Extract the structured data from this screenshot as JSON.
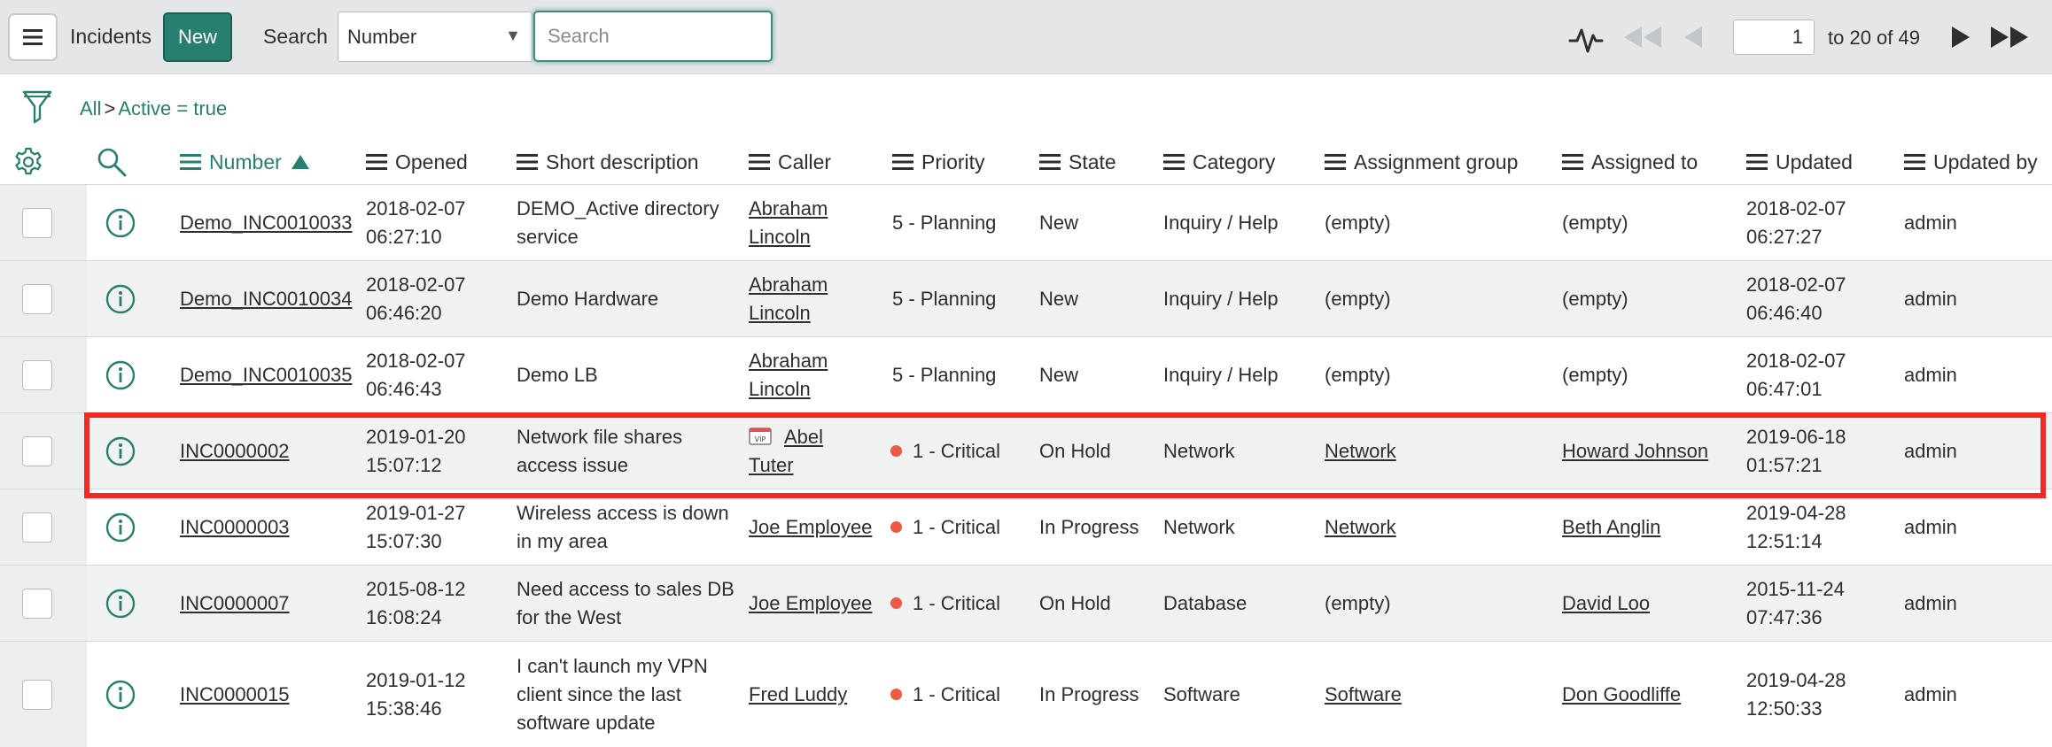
{
  "header": {
    "module_title": "Incidents",
    "new_label": "New",
    "search_label": "Search",
    "field_select_value": "Number",
    "search_placeholder": "Search",
    "page_number": "1",
    "page_range": "to 20 of 49"
  },
  "breadcrumb": {
    "all": "All",
    "separator": ">",
    "filter": "Active = true"
  },
  "columns": [
    {
      "label": "Number",
      "sorted": "ascending"
    },
    {
      "label": "Opened"
    },
    {
      "label": "Short description"
    },
    {
      "label": "Caller"
    },
    {
      "label": "Priority"
    },
    {
      "label": "State"
    },
    {
      "label": "Category"
    },
    {
      "label": "Assignment group"
    },
    {
      "label": "Assigned to"
    },
    {
      "label": "Updated"
    },
    {
      "label": "Updated by"
    }
  ],
  "rows": [
    {
      "number": "Demo_INC0010033",
      "opened_date": "2018-02-07",
      "opened_time": "06:27:10",
      "desc1": "DEMO_Active directory",
      "desc2": "service",
      "desc3": "",
      "caller1": "Abraham",
      "caller2": "Lincoln",
      "vip": false,
      "priority": "5 - Planning",
      "priority_dot": false,
      "state": "New",
      "category": "Inquiry / Help",
      "group": "(empty)",
      "group_link": false,
      "assigned": "(empty)",
      "assigned_link": false,
      "updated_date": "2018-02-07",
      "updated_time": "06:27:27",
      "updated_by": "admin"
    },
    {
      "number": "Demo_INC0010034",
      "opened_date": "2018-02-07",
      "opened_time": "06:46:20",
      "desc1": "Demo Hardware",
      "desc2": "",
      "desc3": "",
      "caller1": "Abraham",
      "caller2": "Lincoln",
      "vip": false,
      "priority": "5 - Planning",
      "priority_dot": false,
      "state": "New",
      "category": "Inquiry / Help",
      "group": "(empty)",
      "group_link": false,
      "assigned": "(empty)",
      "assigned_link": false,
      "updated_date": "2018-02-07",
      "updated_time": "06:46:40",
      "updated_by": "admin"
    },
    {
      "number": "Demo_INC0010035",
      "opened_date": "2018-02-07",
      "opened_time": "06:46:43",
      "desc1": "Demo LB",
      "desc2": "",
      "desc3": "",
      "caller1": "Abraham",
      "caller2": "Lincoln",
      "vip": false,
      "priority": "5 - Planning",
      "priority_dot": false,
      "state": "New",
      "category": "Inquiry / Help",
      "group": "(empty)",
      "group_link": false,
      "assigned": "(empty)",
      "assigned_link": false,
      "updated_date": "2018-02-07",
      "updated_time": "06:47:01",
      "updated_by": "admin"
    },
    {
      "number": "INC0000002",
      "opened_date": "2019-01-20",
      "opened_time": "15:07:12",
      "desc1": "Network file shares",
      "desc2": "access issue",
      "desc3": "",
      "caller1": "Abel",
      "caller2": "Tuter",
      "vip": true,
      "priority": "1 - Critical",
      "priority_dot": true,
      "state": "On Hold",
      "category": "Network",
      "group": "Network",
      "group_link": true,
      "assigned": "Howard Johnson",
      "assigned_link": true,
      "updated_date": "2019-06-18",
      "updated_time": "01:57:21",
      "updated_by": "admin"
    },
    {
      "number": "INC0000003",
      "opened_date": "2019-01-27",
      "opened_time": "15:07:30",
      "desc1": "Wireless access is down",
      "desc2": "in my area",
      "desc3": "",
      "caller1": "Joe Employee",
      "caller2": "",
      "vip": false,
      "priority": "1 - Critical",
      "priority_dot": true,
      "state": "In Progress",
      "category": "Network",
      "group": "Network",
      "group_link": true,
      "assigned": "Beth Anglin",
      "assigned_link": true,
      "updated_date": "2019-04-28",
      "updated_time": "12:51:14",
      "updated_by": "admin"
    },
    {
      "number": "INC0000007",
      "opened_date": "2015-08-12",
      "opened_time": "16:08:24",
      "desc1": "Need access to sales DB",
      "desc2": "for the West",
      "desc3": "",
      "caller1": "Joe Employee",
      "caller2": "",
      "vip": false,
      "priority": "1 - Critical",
      "priority_dot": true,
      "state": "On Hold",
      "category": "Database",
      "group": "(empty)",
      "group_link": false,
      "assigned": "David Loo",
      "assigned_link": true,
      "updated_date": "2015-11-24",
      "updated_time": "07:47:36",
      "updated_by": "admin"
    },
    {
      "number": "INC0000015",
      "opened_date": "2019-01-12",
      "opened_time": "15:38:46",
      "desc1": "I can't launch my VPN",
      "desc2": "client since the last",
      "desc3": "software update",
      "caller1": "Fred Luddy",
      "caller2": "",
      "vip": false,
      "priority": "1 - Critical",
      "priority_dot": true,
      "state": "In Progress",
      "category": "Software",
      "group": "Software",
      "group_link": true,
      "assigned": "Don Goodliffe",
      "assigned_link": true,
      "updated_date": "2019-04-28",
      "updated_time": "12:50:33",
      "updated_by": "admin"
    }
  ],
  "colors": {
    "accent": "#27806f",
    "critical_dot": "#ec5a44",
    "highlight": "#ee2a23",
    "header_bg": "#e4e6e7"
  },
  "icons": [
    "menu-icon",
    "activity-stream-icon",
    "first-page-icon",
    "previous-page-icon",
    "next-page-icon",
    "last-page-icon",
    "filter-icon",
    "gear-icon",
    "search-icon",
    "info-icon",
    "vip-icon"
  ]
}
